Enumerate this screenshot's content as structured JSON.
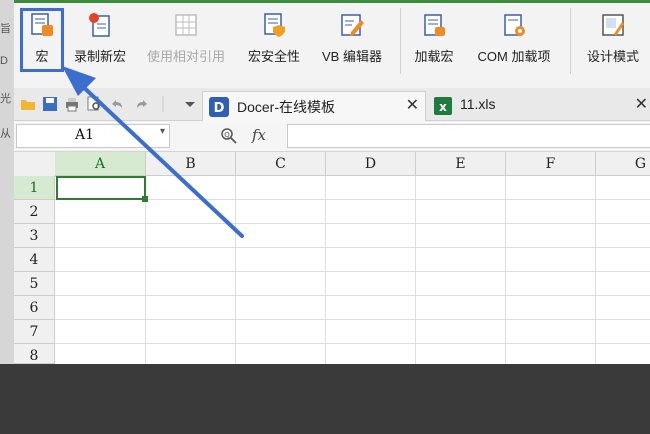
{
  "ribbon": {
    "buttons": [
      {
        "label": "宏",
        "icon": "macro-icon"
      },
      {
        "label": "录制新宏",
        "icon": "record-macro-icon"
      },
      {
        "label": "使用相对引用",
        "icon": "relative-reference-icon",
        "disabled": true
      },
      {
        "label": "宏安全性",
        "icon": "macro-security-icon"
      },
      {
        "label": "VB 编辑器",
        "icon": "vb-editor-icon"
      },
      {
        "label": "加载宏",
        "icon": "addins-icon"
      },
      {
        "label": "COM 加载项",
        "icon": "com-addins-icon"
      },
      {
        "label": "设计模式",
        "icon": "design-mode-icon"
      }
    ]
  },
  "tabs": [
    {
      "label": "Docer-在线模板",
      "icon": "docer-icon"
    },
    {
      "label": "11.xls",
      "icon": "excel-file-icon"
    }
  ],
  "formula_bar": {
    "name_box": "A1",
    "fx_label": "fx",
    "value": ""
  },
  "sheet": {
    "columns": [
      "A",
      "B",
      "C",
      "D",
      "E",
      "F",
      "G"
    ],
    "rows": [
      "1",
      "2",
      "3",
      "4",
      "5",
      "6",
      "7",
      "8"
    ],
    "selected_cell": "A1"
  },
  "colors": {
    "accent_green": "#3d8b3d",
    "highlight_blue": "#3b6ecf",
    "selection_green": "#2e7d32"
  }
}
